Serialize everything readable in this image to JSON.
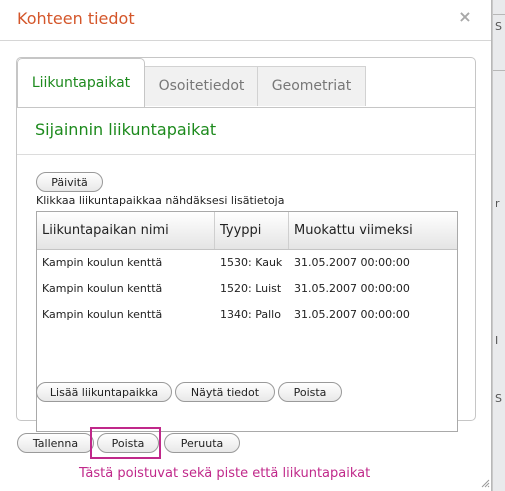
{
  "map": {
    "side_texts": [
      "S",
      "r",
      "I",
      "S"
    ]
  },
  "dialog": {
    "title": "Kohteen tiedot",
    "close_symbol": "×",
    "tabs": [
      {
        "label": "Liikuntapaikat",
        "active": true
      },
      {
        "label": "Osoitetiedot",
        "active": false
      },
      {
        "label": "Geometriat",
        "active": false
      }
    ],
    "section_title": "Sijainnin liikuntapaikat",
    "refresh_label": "Päivitä",
    "hint": "Klikkaa liikuntapaikkaa nähdäksesi lisätietoja",
    "table": {
      "headers": [
        "Liikuntapaikan nimi",
        "Tyyppi",
        "Muokattu viimeksi"
      ],
      "rows": [
        [
          "Kampin koulun kenttä",
          "1530: Kauk",
          "31.05.2007 00:00:00"
        ],
        [
          "Kampin koulun kenttä",
          "1520: Luist",
          "31.05.2007 00:00:00"
        ],
        [
          "Kampin koulun kenttä",
          "1340: Pallo",
          "31.05.2007 00:00:00"
        ]
      ]
    },
    "panel_buttons": {
      "add": "Lisää liikuntapaikka",
      "show": "Näytä tiedot",
      "delete": "Poista"
    },
    "footer_buttons": {
      "save": "Tallenna",
      "delete": "Poista",
      "cancel": "Peruuta"
    },
    "annotation": "Tästä poistuvat sekä piste että liikuntapaikat",
    "colors": {
      "title": "#d4562a",
      "accent_green": "#1d8a1d",
      "annotation": "#c0288a"
    }
  }
}
